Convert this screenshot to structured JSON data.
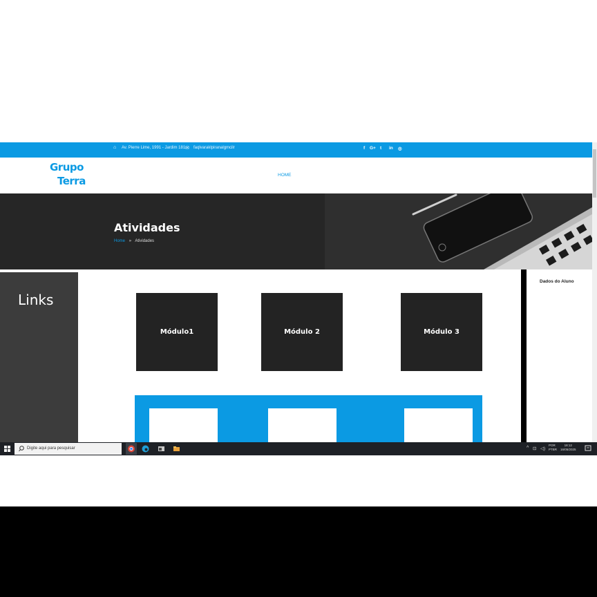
{
  "topbar": {
    "address": "Av. Pierre Lime, 1991 - Jardim 181",
    "email": "faqlvaraklpiranalgmcilr",
    "social": [
      "f",
      "G+",
      "t",
      "in",
      "◎"
    ]
  },
  "header": {
    "logo_line1": "Grupo",
    "logo_line2": "Terra",
    "nav_home": "HOME"
  },
  "hero": {
    "title": "Atividades",
    "breadcrumb_home": "Home",
    "breadcrumb_sep": "»",
    "breadcrumb_current": "Atividades"
  },
  "sidebar_left": {
    "title": "Links"
  },
  "modules": [
    {
      "label": "Módulo1"
    },
    {
      "label": "Módulo 2"
    },
    {
      "label": "Módulo 3"
    }
  ],
  "sidebar_right": {
    "title": "Dados do Aluno"
  },
  "taskbar": {
    "search_placeholder": "Digite aqui para pesquisar",
    "lang": "POR",
    "layout": "PTBR",
    "time": "18:12",
    "date": "16/05/2025"
  },
  "colors": {
    "accent": "#0b9ae3",
    "dark": "#232323"
  }
}
